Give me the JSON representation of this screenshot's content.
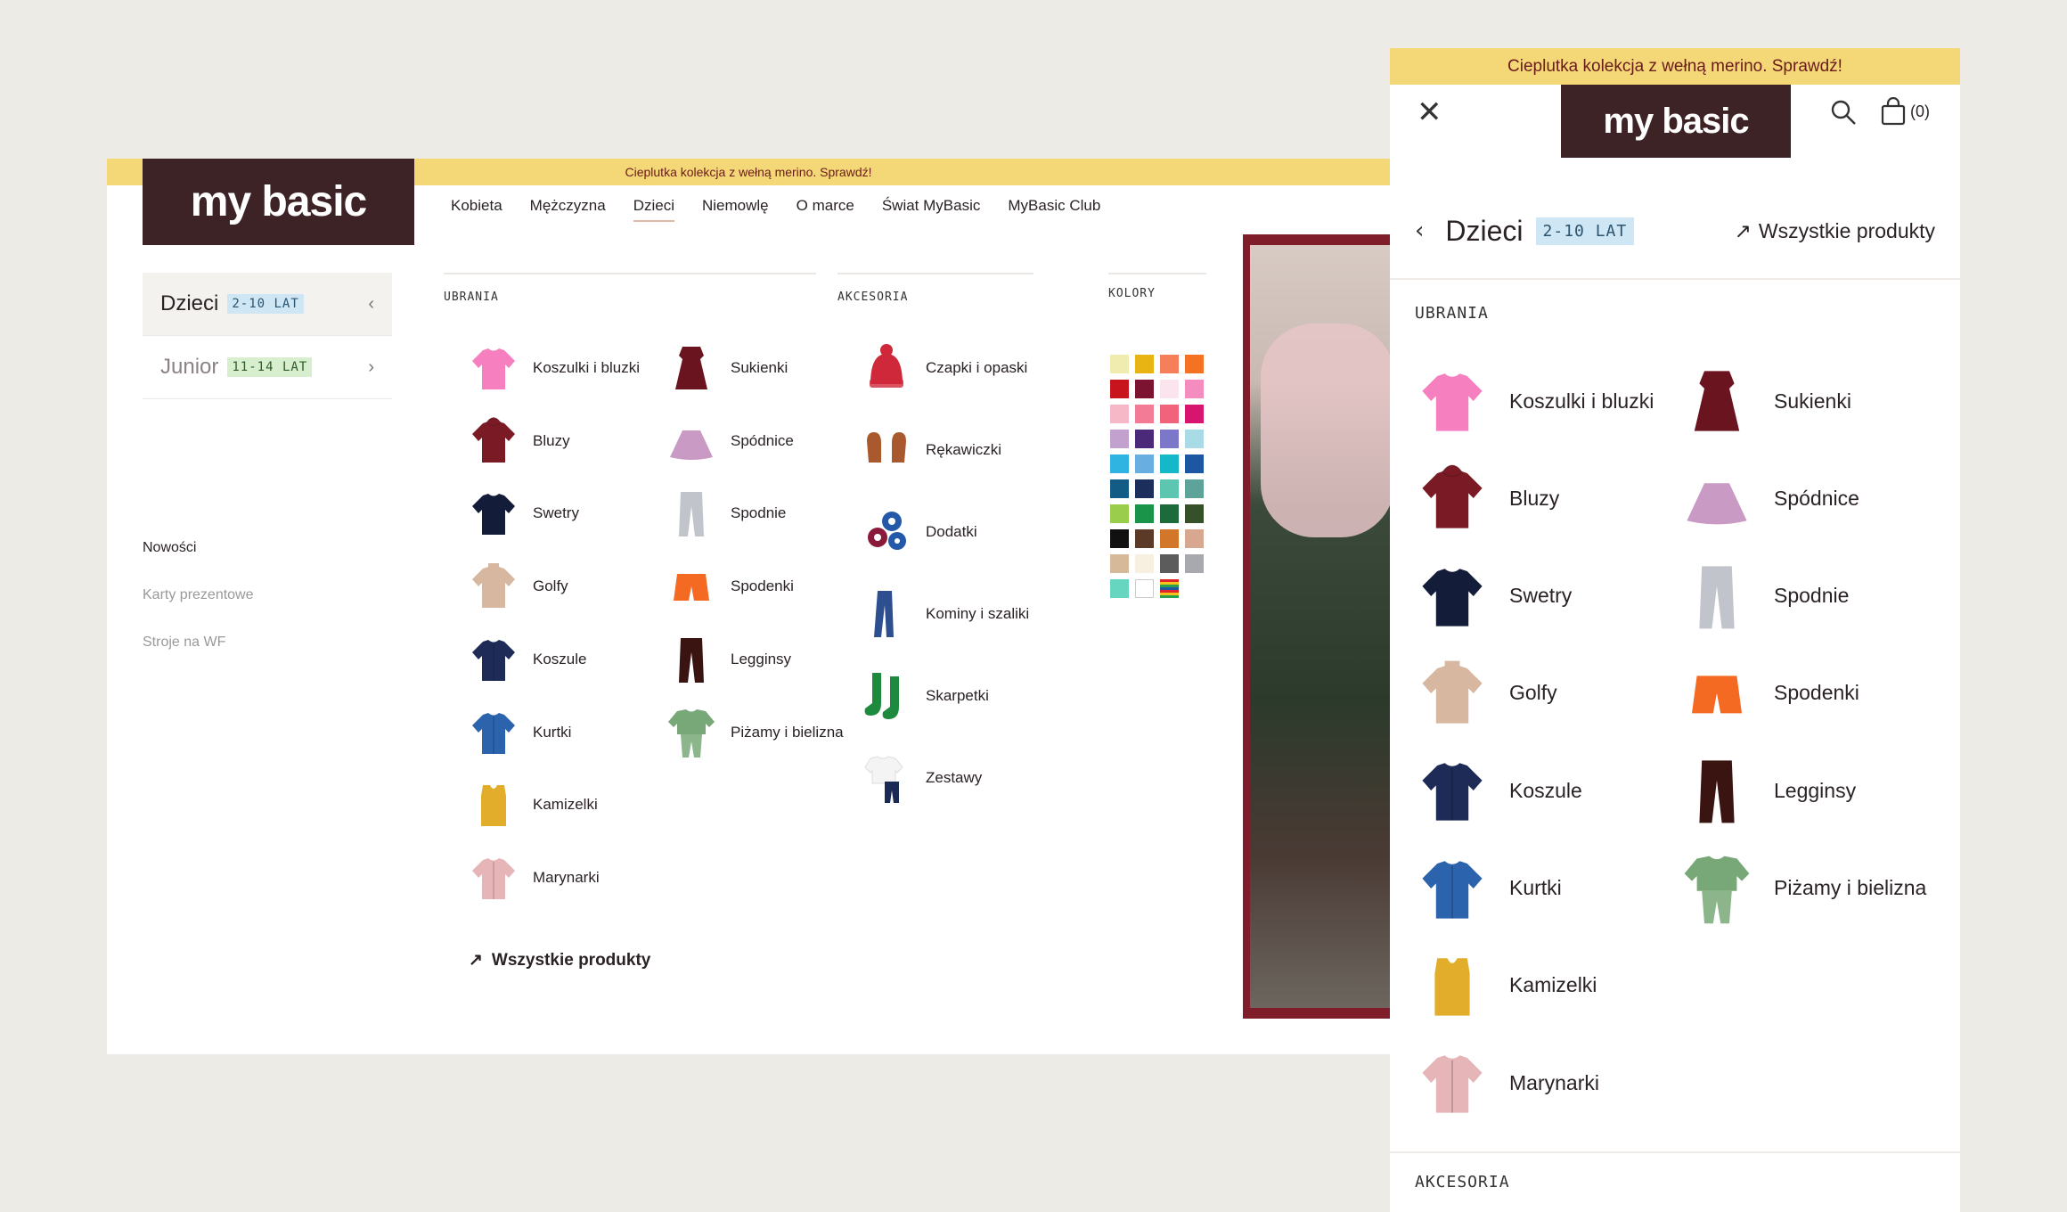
{
  "desktop": {
    "banner": "Cieplutka kolekcja z wełną merino. Sprawdź!",
    "logo": "my basic",
    "nav": [
      "Kobieta",
      "Mężczyzna",
      "Dzieci",
      "Niemowlę",
      "O marce",
      "Świat MyBasic",
      "MyBasic Club"
    ],
    "sidebar": [
      {
        "label": "Dzieci",
        "tag": "2-10 LAT",
        "chevron": "‹"
      },
      {
        "label": "Junior",
        "tag": "11-14 LAT",
        "chevron": "›"
      }
    ],
    "sidelinks": [
      "Nowości",
      "Karty prezentowe",
      "Stroje na WF"
    ],
    "ubrania_head": "UBRANIA",
    "akcesoria_head": "AKCESORIA",
    "kolory_head": "KOLORY",
    "ubrania_col1": [
      "Koszulki i bluzki",
      "Bluzy",
      "Swetry",
      "Golfy",
      "Koszule",
      "Kurtki",
      "Kamizelki",
      "Marynarki"
    ],
    "ubrania_col2": [
      "Sukienki",
      "Spódnice",
      "Spodnie",
      "Spodenki",
      "Legginsy",
      "Piżamy i bielizna"
    ],
    "akcesoria": [
      "Czapki i opaski",
      "Rękawiczki",
      "Dodatki",
      "Kominy i szaliki",
      "Skarpetki",
      "Zestawy"
    ],
    "all_products": "Wszystkie produkty",
    "colors": [
      "#f0ecb0",
      "#e8b414",
      "#f47f5a",
      "#f47222",
      "#c8141c",
      "#7c1330",
      "#fbe4ee",
      "#f58cbf",
      "#f6b7c6",
      "#f47b96",
      "#f0637a",
      "#d7156f",
      "#c2a1cf",
      "#4b2a7a",
      "#7c77c9",
      "#a8dbe6",
      "#2fb4e2",
      "#68aee0",
      "#14b8c8",
      "#1d56a2",
      "#125c86",
      "#1c2e5c",
      "#5dc6b1",
      "#5ea39a",
      "#9acd4c",
      "#199449",
      "#1d6a3a",
      "#36502a",
      "#111111",
      "#5b3a27",
      "#d2772a",
      "#d8a78f",
      "#d6b999",
      "#f7efe0",
      "#5c5c5c",
      "#a7a9ae",
      "#67d6c1",
      "#ffffff",
      "stripes",
      ""
    ]
  },
  "mobile": {
    "banner": "Cieplutka kolekcja z wełną merino. Sprawdź!",
    "logo": "my basic",
    "cart_count": "(0)",
    "title": "Dzieci",
    "tag": "2-10 LAT",
    "all_products": "Wszystkie produkty",
    "ubrania_head": "UBRANIA",
    "akcesoria_head": "AKCESORIA",
    "col1": [
      "Koszulki i bluzki",
      "Bluzy",
      "Swetry",
      "Golfy",
      "Koszule",
      "Kurtki",
      "Kamizelki",
      "Marynarki"
    ],
    "col2": [
      "Sukienki",
      "Spódnice",
      "Spodnie",
      "Spodenki",
      "Legginsy",
      "Piżamy i bielizna"
    ]
  },
  "icons": {
    "Koszulki i bluzki": "tshirt-icon",
    "Bluzy": "hoodie-icon",
    "Swetry": "sweater-icon",
    "Golfy": "turtleneck-icon",
    "Koszule": "shirt-icon",
    "Kurtki": "jacket-icon",
    "Kamizelki": "vest-icon",
    "Marynarki": "blazer-icon",
    "Sukienki": "dress-icon",
    "Spódnice": "skirt-icon",
    "Spodnie": "trousers-icon",
    "Spodenki": "shorts-icon",
    "Legginsy": "leggings-icon",
    "Piżamy i bielizna": "pajamas-icon",
    "Czapki i opaski": "beanie-icon",
    "Rękawiczki": "mittens-icon",
    "Dodatki": "scrunchies-icon",
    "Kominy i szaliki": "scarf-icon",
    "Skarpetki": "socks-icon",
    "Zestawy": "set-icon"
  },
  "icon_colors": {
    "Koszulki i bluzki": "#f57fbf",
    "Bluzy": "#7a1a24",
    "Swetry": "#131c38",
    "Golfy": "#d8b7a0",
    "Koszule": "#1e2b57",
    "Kurtki": "#2b63ad",
    "Kamizelki": "#e2ad2a",
    "Marynarki": "#e6b5b8",
    "Sukienki": "#6a1420",
    "Spódnice": "#c99ac4",
    "Spodnie": "#c2c4cb",
    "Spodenki": "#f46a23",
    "Legginsy": "#3a1410",
    "Piżamy i bielizna": "#78a878",
    "Czapki i opaski": "#d0283b",
    "Rękawiczki": "#a85a2e",
    "Dodatki": "#2458a8",
    "Kominy i szaliki": "#2d4f8f",
    "Skarpetki": "#1d8a3d",
    "Zestawy": "#1a2a55"
  }
}
